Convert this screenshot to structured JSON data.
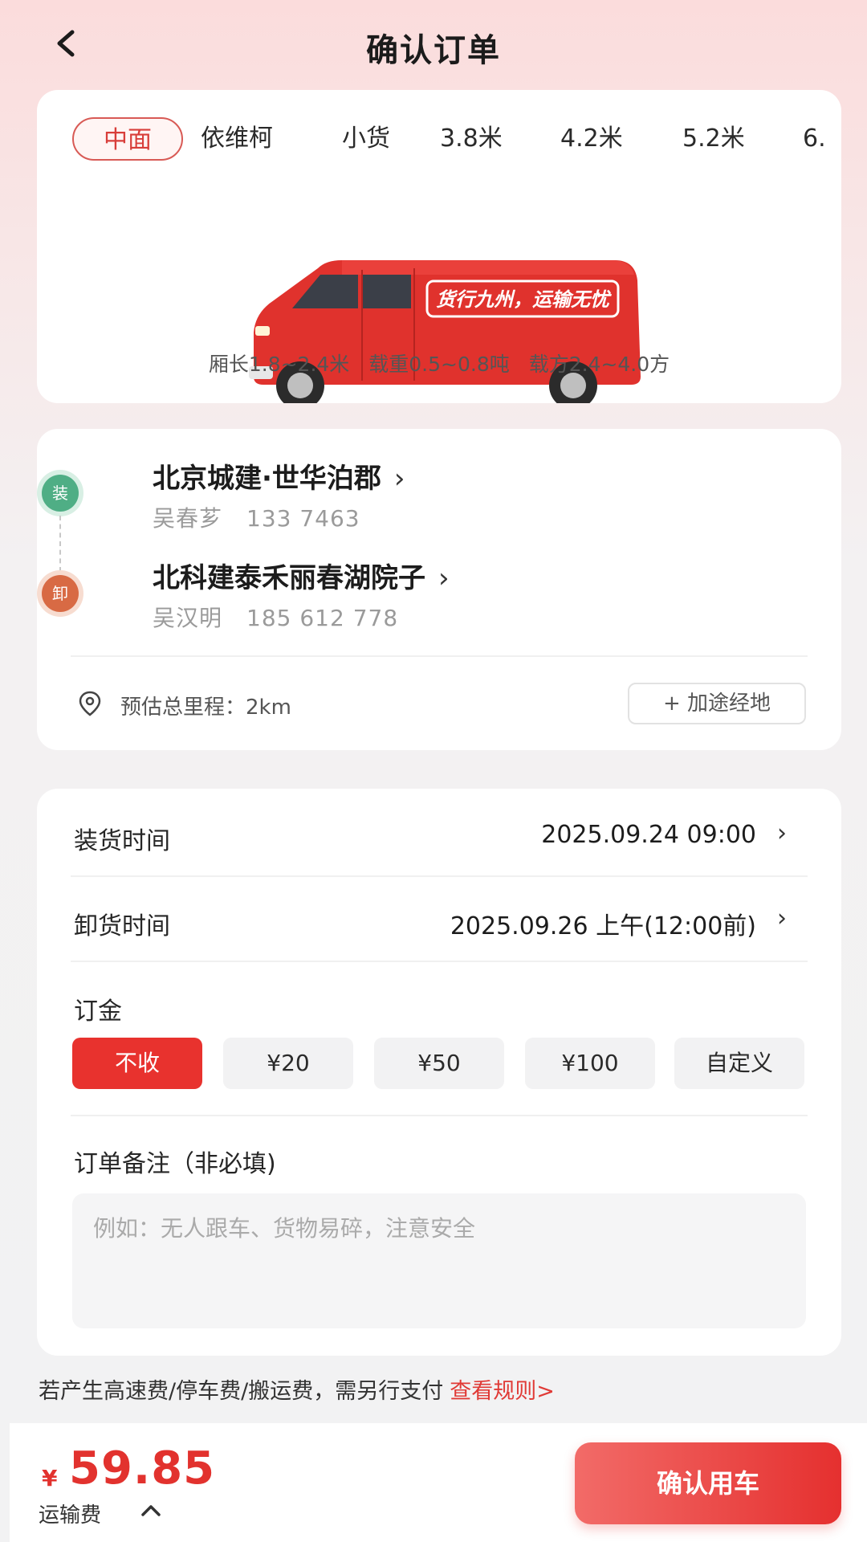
{
  "header": {
    "title": "确认订单"
  },
  "vehicle": {
    "tabs": [
      {
        "label": "中面",
        "active": true
      },
      {
        "label": "依维柯",
        "active": false
      },
      {
        "label": "小货",
        "active": false
      },
      {
        "label": "3.8米",
        "active": false
      },
      {
        "label": "4.2米",
        "active": false
      },
      {
        "label": "5.2米",
        "active": false
      },
      {
        "label": "6.",
        "active": false
      }
    ],
    "van_slogan": "货行九州，运输无忧",
    "specs": {
      "box_length": "厢长1.8~2.4米",
      "load_weight": "载重0.5~0.8吨",
      "load_volume": "载方2.4~4.0方"
    },
    "colors": {
      "van": "#e0322d",
      "accent": "#d83e3a"
    }
  },
  "route": {
    "load": {
      "badge": "装",
      "address": "北京城建·世华泊郡",
      "contact_name": "吴春芗",
      "phone": "133 7463"
    },
    "unload": {
      "badge": "卸",
      "address": "北科建泰禾丽春湖院子",
      "contact_name": "吴汉明",
      "phone": "185 612 778"
    },
    "mileage": "预估总里程：2km",
    "add_waypoint": "+ 加途经地"
  },
  "order": {
    "load_time_label": "装货时间",
    "load_time_value": "2025.09.24 09:00",
    "unload_time_label": "卸货时间",
    "unload_time_value": "2025.09.26 上午(12:00前)",
    "deposit_label": "订金",
    "deposit_options": [
      {
        "label": "不收",
        "active": true
      },
      {
        "label": "¥20",
        "active": false
      },
      {
        "label": "¥50",
        "active": false
      },
      {
        "label": "¥100",
        "active": false
      },
      {
        "label": "自定义",
        "active": false
      }
    ],
    "notes_label": "订单备注（非必填)",
    "notes_placeholder": "例如：无人跟车、货物易碎，注意安全"
  },
  "fee_note": {
    "text": "若产生高速费/停车费/搬运费，需另行支付",
    "link": "查看规则>"
  },
  "footer": {
    "currency": "¥",
    "price": "59.85",
    "fee_label": "运输费",
    "confirm_label": "确认用车"
  },
  "icons": [
    "back-arrow-icon",
    "chevron-right-icon",
    "location-pin-icon",
    "chevron-up-icon"
  ]
}
